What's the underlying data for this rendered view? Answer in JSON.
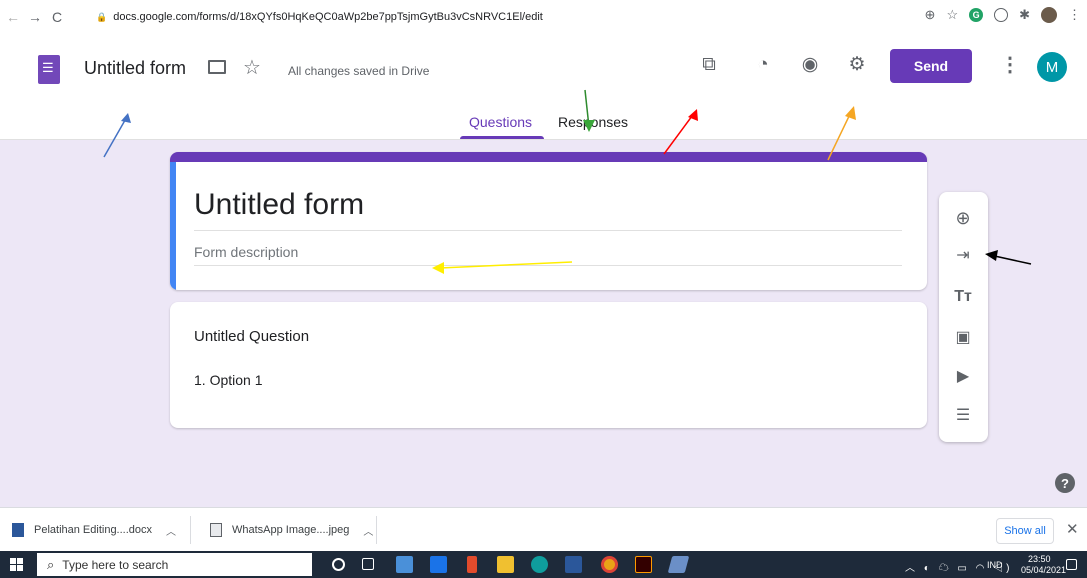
{
  "browser": {
    "url": "docs.google.com/forms/d/18xQYfs0HqKeQC0aWp2be7ppTsjmGytBu3vCsNRVC1El/edit"
  },
  "header": {
    "doc_title": "Untitled form",
    "save_status": "All changes saved in Drive",
    "send_label": "Send",
    "avatar_letter": "M",
    "accent_color": "#673ab7"
  },
  "tabs": [
    {
      "label": "Questions",
      "active": true
    },
    {
      "label": "Responses",
      "active": false
    }
  ],
  "form": {
    "title": "Untitled form",
    "description_placeholder": "Form description"
  },
  "question": {
    "title": "Untitled Question",
    "option_1": "1.  Option 1"
  },
  "toolbar": [
    "add-question-icon",
    "import-questions-icon",
    "add-title-icon",
    "add-image-icon",
    "add-video-icon",
    "add-section-icon"
  ],
  "downloads": {
    "items": [
      {
        "name": "Pelatihan Editing....docx"
      },
      {
        "name": "WhatsApp Image....jpeg"
      }
    ],
    "show_all": "Show all"
  },
  "taskbar": {
    "search_placeholder": "Type here to search",
    "language": "IND",
    "time": "23:50",
    "date": "05/04/2021"
  }
}
